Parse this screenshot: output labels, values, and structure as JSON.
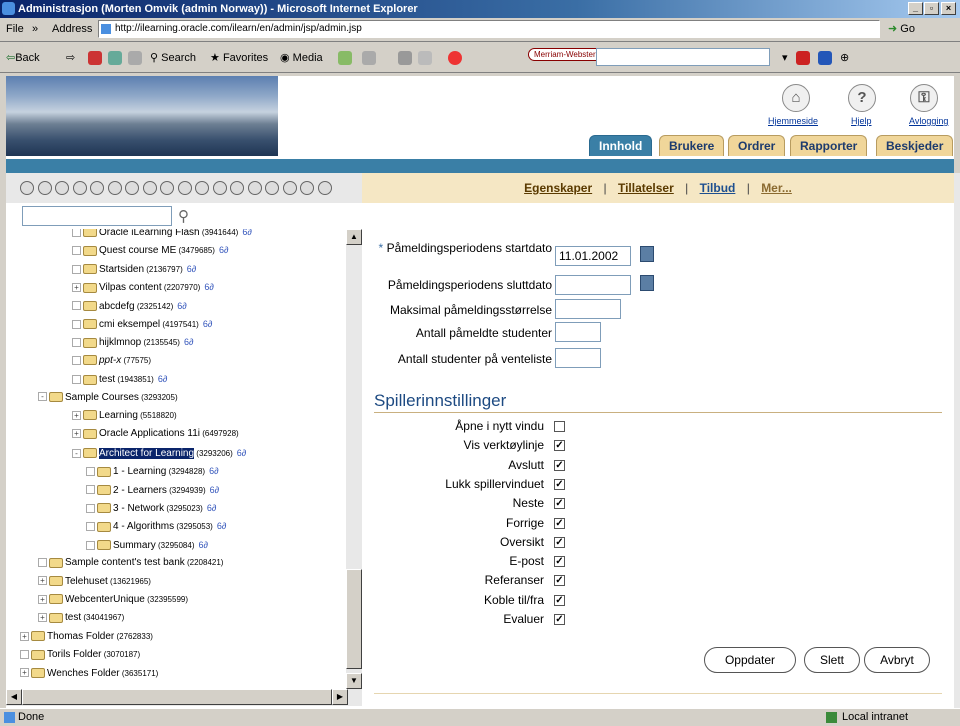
{
  "window": {
    "title": "Administrasjon (Morten Omvik (admin Norway)) - Microsoft Internet Explorer"
  },
  "menubar": {
    "file": "File",
    "more": "»",
    "address_label": "Address",
    "address_value": "http://ilearning.oracle.com/ilearn/en/admin/jsp/admin.jsp",
    "go": "Go"
  },
  "toolbar": {
    "back": "Back",
    "search": "Search",
    "favorites": "Favorites",
    "media": "Media",
    "merriam": "Merriam-Webster"
  },
  "header": {
    "links": {
      "home": "Hjemmeside",
      "help": "Hjelp",
      "logout": "Avlogging"
    },
    "tabs": [
      "Innhold",
      "Brukere",
      "Ordrer",
      "Rapporter",
      "Beskjeder"
    ],
    "active_tab": "Innhold"
  },
  "subnav": {
    "properties": "Egenskaper",
    "permissions": "Tillatelser",
    "offers": "Tilbud",
    "more": "Mer..."
  },
  "tree": [
    {
      "label": "Oracle iLearning Flash",
      "count": "(3941644)",
      "level": 2,
      "offering": true
    },
    {
      "label": "Quest course ME",
      "count": "(3479685)",
      "level": 2,
      "offering": true
    },
    {
      "label": "Startsiden",
      "count": "(2136797)",
      "level": 2,
      "offering": true
    },
    {
      "label": "Vilpas content",
      "count": "(2207970)",
      "level": 2,
      "offering": true,
      "expand": "+"
    },
    {
      "label": "abcdefg",
      "count": "(2325142)",
      "level": 2,
      "offering": true
    },
    {
      "label": "cmi eksempel",
      "count": "(4197541)",
      "level": 2,
      "offering": true
    },
    {
      "label": "hijklmnop",
      "count": "(2135545)",
      "level": 2,
      "offering": true
    },
    {
      "label": "ppt-x",
      "count": "(77575)",
      "level": 2,
      "offering": false
    },
    {
      "label": "test",
      "count": "(1943851)",
      "level": 2,
      "offering": true
    },
    {
      "label": "Sample Courses",
      "count": "(3293205)",
      "level": 1,
      "offering": false,
      "expand": "-"
    },
    {
      "label": "Learning",
      "count": "(5518820)",
      "level": 2,
      "offering": false,
      "expand": "+"
    },
    {
      "label": "Oracle Applications 11i",
      "count": "(6497928)",
      "level": 2,
      "offering": false,
      "expand": "+"
    },
    {
      "label": "Architect for Learning",
      "count": "(3293206)",
      "level": 2,
      "offering": true,
      "expand": "-",
      "selected": true
    },
    {
      "label": "1 - Learning",
      "count": "(3294828)",
      "level": 3,
      "offering": true
    },
    {
      "label": "2 - Learners",
      "count": "(3294939)",
      "level": 3,
      "offering": true
    },
    {
      "label": "3 - Network",
      "count": "(3295023)",
      "level": 3,
      "offering": true
    },
    {
      "label": "4 - Algorithms",
      "count": "(3295053)",
      "level": 3,
      "offering": true
    },
    {
      "label": "Summary",
      "count": "(3295084)",
      "level": 3,
      "offering": true
    },
    {
      "label": "Sample content's test bank",
      "count": "(2208421)",
      "level": 1,
      "offering": false
    },
    {
      "label": "Telehuset",
      "count": "(13621965)",
      "level": 1,
      "offering": false,
      "expand": "+"
    },
    {
      "label": "WebcenterUnique",
      "count": "(32395599)",
      "level": 1,
      "offering": false,
      "expand": "+"
    },
    {
      "label": "test",
      "count": "(34041967)",
      "level": 1,
      "offering": false,
      "expand": "+"
    },
    {
      "label": "Thomas Folder",
      "count": "(2762833)",
      "level": 0,
      "offering": false,
      "expand": "+"
    },
    {
      "label": "Torils Folder",
      "count": "(3070187)",
      "level": 0,
      "offering": false
    },
    {
      "label": "Wenches Folder",
      "count": "(3635171)",
      "level": 0,
      "offering": false,
      "expand": "+"
    }
  ],
  "offering_glyph": "6∂",
  "form": {
    "required_star": "*",
    "start_label": "Påmeldingsperiodens startdato",
    "start_value": "11.01.2002",
    "end_label": "Påmeldingsperiodens sluttdato",
    "end_value": "",
    "max_label": "Maksimal påmeldingsstørrelse",
    "enrolled_label": "Antall påmeldte studenter",
    "waitlist_label": "Antall studenter på venteliste"
  },
  "player": {
    "heading": "Spillerinnstillinger",
    "options": [
      {
        "label": "Åpne i nytt vindu",
        "checked": false
      },
      {
        "label": "Vis verktøylinje",
        "checked": true
      },
      {
        "label": "Avslutt",
        "checked": true
      },
      {
        "label": "Lukk spillervinduet",
        "checked": true
      },
      {
        "label": "Neste",
        "checked": true
      },
      {
        "label": "Forrige",
        "checked": true
      },
      {
        "label": "Oversikt",
        "checked": true
      },
      {
        "label": "E-post",
        "checked": true
      },
      {
        "label": "Referanser",
        "checked": true
      },
      {
        "label": "Koble til/fra",
        "checked": true
      },
      {
        "label": "Evaluer",
        "checked": true
      }
    ]
  },
  "buttons": {
    "update": "Oppdater",
    "delete": "Slett",
    "cancel": "Avbryt"
  },
  "status": {
    "left": "Done",
    "zone": "Local intranet"
  },
  "colors": {
    "accent": "#3a7fa6",
    "tab_inactive": "#f0d69a",
    "heading": "#1d4a82"
  }
}
